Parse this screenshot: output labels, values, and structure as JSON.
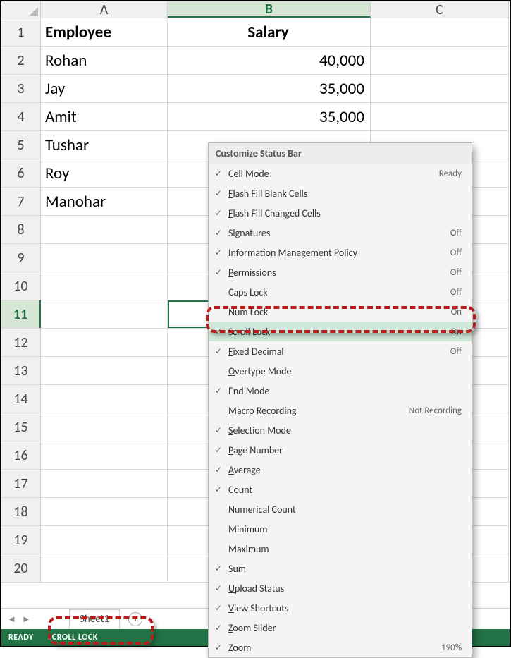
{
  "columns": {
    "a": "A",
    "b": "B",
    "c": "C"
  },
  "headers": {
    "employee": "Employee",
    "salary": "Salary"
  },
  "data_rows": [
    {
      "num": "1",
      "a": "Employee",
      "b": "Salary",
      "header": true
    },
    {
      "num": "2",
      "a": "Rohan",
      "b": "40,000"
    },
    {
      "num": "3",
      "a": "Jay",
      "b": "35,000"
    },
    {
      "num": "4",
      "a": "Amit",
      "b": "35,000"
    },
    {
      "num": "5",
      "a": "Tushar",
      "b": ""
    },
    {
      "num": "6",
      "a": "Roy",
      "b": ""
    },
    {
      "num": "7",
      "a": "Manohar",
      "b": ""
    },
    {
      "num": "8",
      "a": "",
      "b": ""
    },
    {
      "num": "9",
      "a": "",
      "b": ""
    },
    {
      "num": "10",
      "a": "",
      "b": ""
    },
    {
      "num": "11",
      "a": "",
      "b": "",
      "selected": true
    },
    {
      "num": "12",
      "a": "",
      "b": ""
    },
    {
      "num": "13",
      "a": "",
      "b": ""
    },
    {
      "num": "14",
      "a": "",
      "b": ""
    },
    {
      "num": "15",
      "a": "",
      "b": ""
    },
    {
      "num": "16",
      "a": "",
      "b": ""
    },
    {
      "num": "17",
      "a": "",
      "b": ""
    },
    {
      "num": "18",
      "a": "",
      "b": ""
    },
    {
      "num": "19",
      "a": "",
      "b": ""
    },
    {
      "num": "20",
      "a": "",
      "b": ""
    }
  ],
  "sheet_tab": "Sheet1",
  "status": {
    "ready": "READY",
    "scrolllock": "SCROLL LOCK"
  },
  "menu": {
    "title": "Customize Status Bar",
    "items": [
      {
        "check": true,
        "label": "Cell Mode",
        "ul": "",
        "value": "Ready"
      },
      {
        "check": true,
        "label": "Flash Fill Blank Cells",
        "ul": "F",
        "value": ""
      },
      {
        "check": true,
        "label": "Flash Fill Changed Cells",
        "ul": "F",
        "value": ""
      },
      {
        "check": true,
        "label": "Signatures",
        "ul": "",
        "value": "Off"
      },
      {
        "check": true,
        "label": "Information Management Policy",
        "ul": "I",
        "value": "Off"
      },
      {
        "check": true,
        "label": "Permissions",
        "ul": "P",
        "value": "Off"
      },
      {
        "check": false,
        "label": "Caps Lock",
        "ul": "",
        "value": "Off"
      },
      {
        "check": false,
        "label": "Num Lock",
        "ul": "",
        "value": "On"
      },
      {
        "check": true,
        "label": "Scroll Lock",
        "ul": "",
        "value": "On",
        "highlight": true
      },
      {
        "check": true,
        "label": "Fixed Decimal",
        "ul": "F",
        "value": "Off"
      },
      {
        "check": false,
        "label": "Overtype Mode",
        "ul": "O",
        "value": ""
      },
      {
        "check": true,
        "label": "End Mode",
        "ul": "",
        "value": ""
      },
      {
        "check": false,
        "label": "Macro Recording",
        "ul": "M",
        "value": "Not Recording"
      },
      {
        "check": true,
        "label": "Selection Mode",
        "ul": "S",
        "value": ""
      },
      {
        "check": true,
        "label": "Page Number",
        "ul": "P",
        "value": ""
      },
      {
        "check": true,
        "label": "Average",
        "ul": "A",
        "value": ""
      },
      {
        "check": true,
        "label": "Count",
        "ul": "C",
        "value": ""
      },
      {
        "check": false,
        "label": "Numerical Count",
        "ul": "",
        "value": ""
      },
      {
        "check": false,
        "label": "Minimum",
        "ul": "",
        "value": ""
      },
      {
        "check": false,
        "label": "Maximum",
        "ul": "",
        "value": ""
      },
      {
        "check": true,
        "label": "Sum",
        "ul": "S",
        "value": ""
      },
      {
        "check": true,
        "label": "Upload Status",
        "ul": "U",
        "value": ""
      },
      {
        "check": true,
        "label": "View Shortcuts",
        "ul": "V",
        "value": ""
      },
      {
        "check": true,
        "label": "Zoom Slider",
        "ul": "Z",
        "value": ""
      },
      {
        "check": true,
        "label": "Zoom",
        "ul": "Z",
        "value": "190%"
      }
    ]
  }
}
